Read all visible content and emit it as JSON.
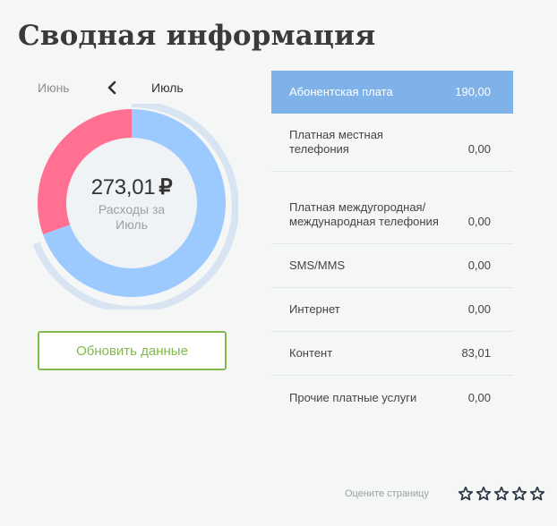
{
  "page": {
    "title": "Сводная информация"
  },
  "month_nav": {
    "prev": "Июнь",
    "current": "Июль"
  },
  "summary": {
    "total": "273,01",
    "currency_sign": "₽",
    "caption": "Расходы за Июль",
    "segments": [
      {
        "label": "Абонентская плата",
        "value": 190.0,
        "color": "#9ccaff"
      },
      {
        "label": "Контент",
        "value": 83.01,
        "color": "#ff7093"
      }
    ]
  },
  "refresh_label": "Обновить данные",
  "services": [
    {
      "name": "Абонентская плата",
      "value": "190,00"
    },
    {
      "name": "Платная местная телефония",
      "value": "0,00"
    },
    {
      "name": "Платная междугородная/ международная телефония",
      "value": "0,00"
    },
    {
      "name": "SMS/MMS",
      "value": "0,00"
    },
    {
      "name": "Интернет",
      "value": "0,00"
    },
    {
      "name": "Контент",
      "value": "83,01"
    },
    {
      "name": "Прочие платные услуги",
      "value": "0,00"
    }
  ],
  "rating": {
    "label": "Оцените страницу",
    "max": 5
  },
  "colors": {
    "accent_green": "#7fba4b",
    "selected_row": "#7fb2e9",
    "donut_blue": "#9ccaff",
    "donut_pink": "#ff7093"
  }
}
